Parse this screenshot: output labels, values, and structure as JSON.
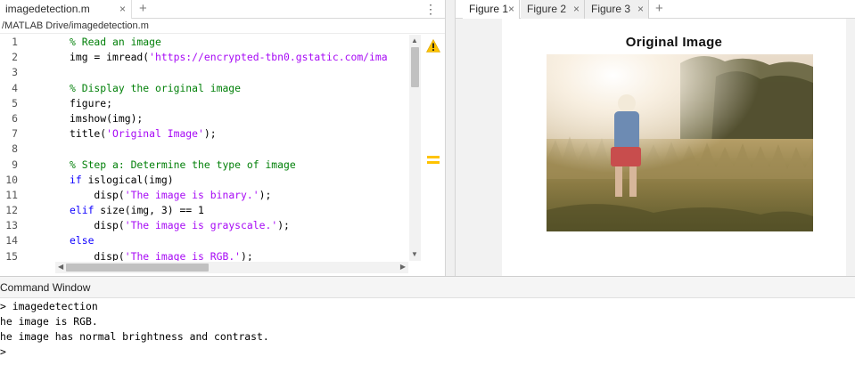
{
  "editor": {
    "tab_label": "imagedetection.m",
    "close_glyph": "×",
    "new_tab_glyph": "+",
    "menu_glyph": "⋮",
    "path": "/MATLAB Drive/imagedetection.m",
    "lines": [
      {
        "n": "1",
        "parts": [
          {
            "t": "cm",
            "s": "% Read an image"
          }
        ]
      },
      {
        "n": "2",
        "parts": [
          {
            "t": "",
            "s": "img = imread("
          },
          {
            "t": "str",
            "s": "'https://encrypted-tbn0.gstatic.com/ima"
          }
        ]
      },
      {
        "n": "3",
        "parts": []
      },
      {
        "n": "4",
        "parts": [
          {
            "t": "cm",
            "s": "% Display the original image"
          }
        ]
      },
      {
        "n": "5",
        "parts": [
          {
            "t": "",
            "s": "figure;"
          }
        ]
      },
      {
        "n": "6",
        "parts": [
          {
            "t": "",
            "s": "imshow(img);"
          }
        ]
      },
      {
        "n": "7",
        "parts": [
          {
            "t": "",
            "s": "title("
          },
          {
            "t": "str",
            "s": "'Original Image'"
          },
          {
            "t": "",
            "s": ");"
          }
        ]
      },
      {
        "n": "8",
        "parts": []
      },
      {
        "n": "9",
        "parts": [
          {
            "t": "cm",
            "s": "% Step a: Determine the type of image"
          }
        ]
      },
      {
        "n": "10",
        "parts": [
          {
            "t": "kw",
            "s": "if"
          },
          {
            "t": "",
            "s": " islogical(img)"
          }
        ]
      },
      {
        "n": "11",
        "parts": [
          {
            "t": "",
            "s": "    disp("
          },
          {
            "t": "str",
            "s": "'The image is binary.'"
          },
          {
            "t": "",
            "s": ");"
          }
        ]
      },
      {
        "n": "12",
        "parts": [
          {
            "t": "kw",
            "s": "elif"
          },
          {
            "t": "",
            "s": " size(img, 3) == 1"
          }
        ]
      },
      {
        "n": "13",
        "parts": [
          {
            "t": "",
            "s": "    disp("
          },
          {
            "t": "str",
            "s": "'The image is grayscale.'"
          },
          {
            "t": "",
            "s": ");"
          }
        ]
      },
      {
        "n": "14",
        "parts": [
          {
            "t": "kw",
            "s": "else"
          }
        ]
      },
      {
        "n": "15",
        "parts": [
          {
            "t": "",
            "s": "    disp("
          },
          {
            "t": "str",
            "s": "'The image is RGB.'"
          },
          {
            "t": "",
            "s": ");"
          }
        ]
      }
    ]
  },
  "figure": {
    "tabs": [
      {
        "label": "Figure 1",
        "active": true
      },
      {
        "label": "Figure 2",
        "active": false
      },
      {
        "label": "Figure 3",
        "active": false
      }
    ],
    "new_tab_glyph": "+",
    "close_glyph": "×",
    "title": "Original Image"
  },
  "command_window": {
    "title": "Command Window",
    "lines": [
      "> imagedetection",
      "he image is RGB.",
      "he image has normal brightness and contrast.",
      ">"
    ]
  },
  "colors": {
    "keyword": "#0e00ff",
    "string": "#a709f5",
    "comment": "#028009",
    "warning": "#ffc300"
  },
  "icons": {
    "warning": "warning-triangle-icon",
    "analyzer": "code-analyzer-equals-icon"
  }
}
